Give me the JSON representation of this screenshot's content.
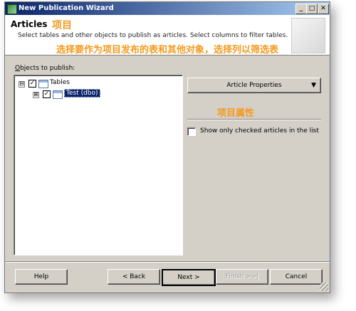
{
  "window": {
    "title": "New Publication Wizard",
    "controls": {
      "minimize": "_",
      "maximize": "□",
      "close": "✕"
    }
  },
  "header": {
    "title": "Articles",
    "title_cn": "项目",
    "description": "Select tables and other objects to publish as articles. Select columns to filter tables.",
    "description_cn": "选择要作为项目发布的表和其他对象，选择列以筛选表"
  },
  "objects": {
    "label_prefix": "O",
    "label_rest": "bjects to publish:",
    "tree": [
      {
        "label": "Tables",
        "expander": "⊟",
        "checked": "✓"
      },
      {
        "label": "Test (dbo)",
        "expander": "⊞",
        "checked": "✓",
        "selected": true
      }
    ]
  },
  "right_panel": {
    "article_properties": "Article Properties",
    "dropdown_arrow": "▼",
    "properties_cn": "项目属性",
    "show_checked_label": "Show only checked articles in the list"
  },
  "buttons": {
    "help": "Help",
    "back": "< Back",
    "next": "Next >",
    "finish": "Finish >>|",
    "cancel": "Cancel"
  },
  "colors": {
    "accent_cn": "#f39a1e",
    "titlebar_start": "#0a246a",
    "titlebar_end": "#a6caf0",
    "dialog_bg": "#d4d0c8",
    "selection_bg": "#0a246a"
  },
  "icons": {
    "app": "app-icon",
    "table": "table-icon",
    "decoration": "wizard-decoration-icon"
  }
}
